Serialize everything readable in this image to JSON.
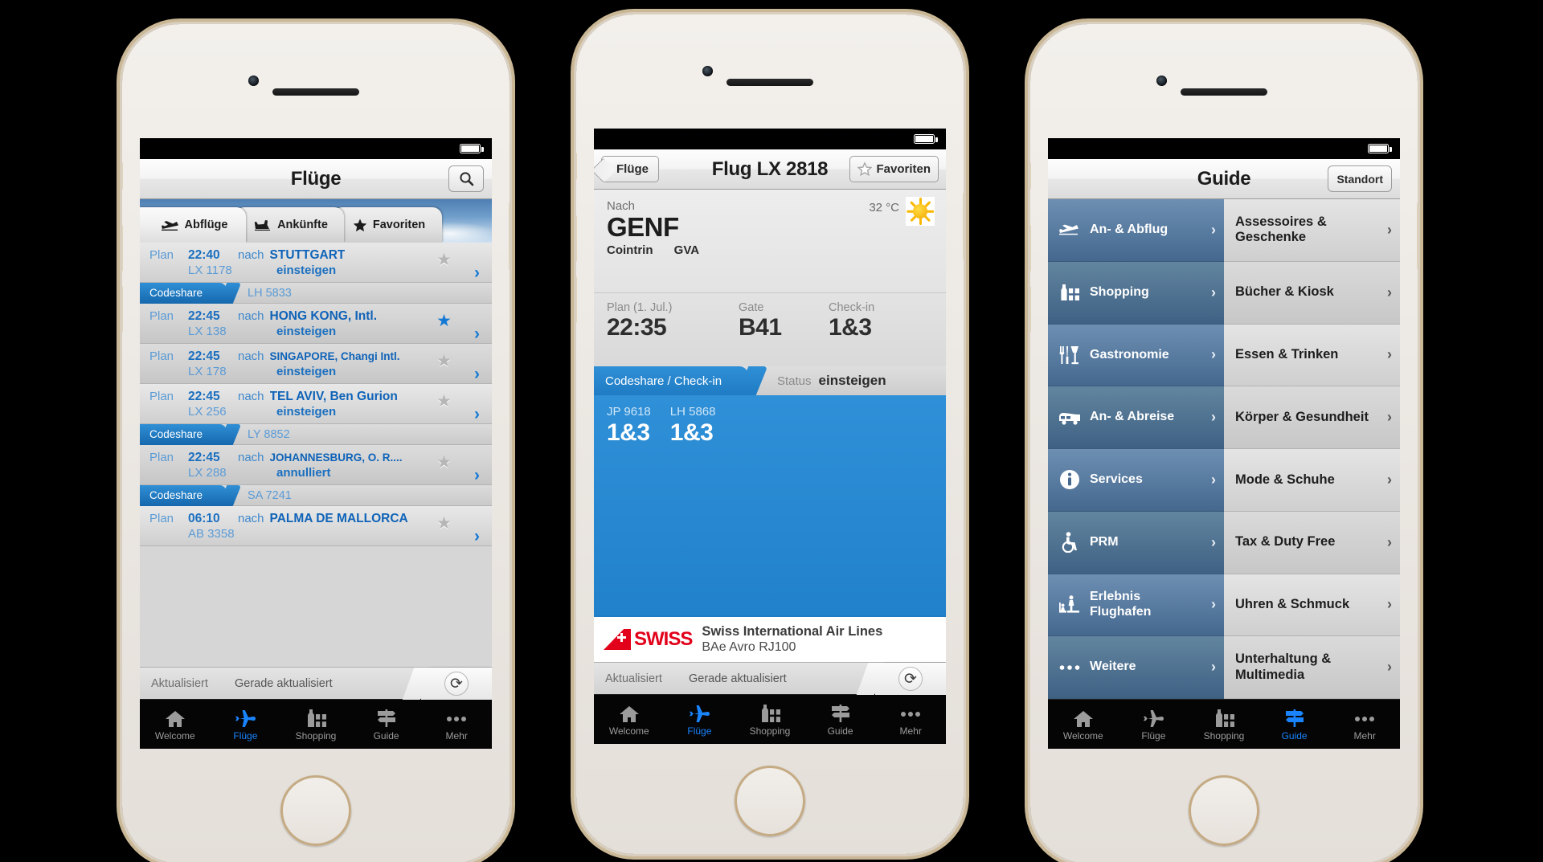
{
  "phone1": {
    "statusbar": {
      "battery": "battery-icon"
    },
    "navbar": {
      "title": "Flüge",
      "search_icon": "search-icon"
    },
    "tabs": [
      {
        "label": "Abflüge",
        "icon": "departure-plane-icon",
        "active": true
      },
      {
        "label": "Ankünfte",
        "icon": "arrival-plane-icon",
        "active": false
      },
      {
        "label": "Favoriten",
        "icon": "star-icon",
        "active": false
      }
    ],
    "flights": [
      {
        "plan": "Plan",
        "time": "22:40",
        "nach": "nach",
        "dest": "STUTTGART",
        "number": "LX 1178",
        "status": "einsteigen",
        "fav": false,
        "codeshare": {
          "tag": "Codeshare",
          "number": "LH 5833"
        }
      },
      {
        "plan": "Plan",
        "time": "22:45",
        "nach": "nach",
        "dest": "HONG KONG, Intl.",
        "number": "LX 138",
        "status": "einsteigen",
        "fav": true,
        "codeshare": null
      },
      {
        "plan": "Plan",
        "time": "22:45",
        "nach": "nach",
        "dest": "SINGAPORE, Changi Intl.",
        "number": "LX 178",
        "status": "einsteigen",
        "fav": false,
        "codeshare": null
      },
      {
        "plan": "Plan",
        "time": "22:45",
        "nach": "nach",
        "dest": "TEL AVIV, Ben Gurion",
        "number": "LX 256",
        "status": "einsteigen",
        "fav": false,
        "codeshare": {
          "tag": "Codeshare",
          "number": "LY 8852"
        }
      },
      {
        "plan": "Plan",
        "time": "22:45",
        "nach": "nach",
        "dest": "JOHANNESBURG, O. R....",
        "number": "LX 288",
        "status": "annulliert",
        "fav": false,
        "codeshare": {
          "tag": "Codeshare",
          "number": "SA 7241"
        }
      },
      {
        "plan": "Plan",
        "time": "06:10",
        "nach": "nach",
        "dest": "PALMA DE MALLORCA",
        "number": "AB 3358",
        "status": "",
        "fav": false,
        "codeshare": null
      }
    ],
    "refreshbar": {
      "left": "Aktualisiert",
      "center": "Gerade aktualisiert",
      "icon": "refresh-icon"
    },
    "tabbar": [
      {
        "label": "Welcome",
        "icon": "home-icon",
        "active": false
      },
      {
        "label": "Flüge",
        "icon": "plane-icon",
        "active": true
      },
      {
        "label": "Shopping",
        "icon": "shopping-icon",
        "active": false
      },
      {
        "label": "Guide",
        "icon": "signpost-icon",
        "active": false
      },
      {
        "label": "Mehr",
        "icon": "ellipsis-icon",
        "active": false
      }
    ]
  },
  "phone2": {
    "navbar": {
      "back": "Flüge",
      "title": "Flug LX 2818",
      "fav_label": "Favoriten",
      "fav_icon": "star-outline-icon"
    },
    "detail": {
      "nach_label": "Nach",
      "city": "GENF",
      "airport": "Cointrin",
      "iata": "GVA",
      "temperature": "32 °C",
      "weather_icon": "sun-icon",
      "fields": [
        {
          "label": "Plan (1. Jul.)",
          "value": "22:35"
        },
        {
          "label": "Gate",
          "value": "B41"
        },
        {
          "label": "Check-in",
          "value": "1&3"
        }
      ],
      "codeshare_header": {
        "tag": "Codeshare / Check-in",
        "status_label": "Status",
        "status_value": "einsteigen"
      },
      "codeshare_items": [
        {
          "number": "JP 9618",
          "checkin": "1&3"
        },
        {
          "number": "LH 5868",
          "checkin": "1&3"
        }
      ],
      "airline": {
        "logo": "swiss-logo",
        "logo_word": "SWISS",
        "name": "Swiss International Air Lines",
        "aircraft": "BAe Avro RJ100"
      }
    },
    "refreshbar": {
      "left": "Aktualisiert",
      "center": "Gerade aktualisiert",
      "icon": "refresh-icon"
    },
    "tabbar": [
      {
        "label": "Welcome",
        "icon": "home-icon",
        "active": false
      },
      {
        "label": "Flüge",
        "icon": "plane-icon",
        "active": true
      },
      {
        "label": "Shopping",
        "icon": "shopping-icon",
        "active": false
      },
      {
        "label": "Guide",
        "icon": "signpost-icon",
        "active": false
      },
      {
        "label": "Mehr",
        "icon": "ellipsis-icon",
        "active": false
      }
    ]
  },
  "phone3": {
    "navbar": {
      "title": "Guide",
      "button": "Standort"
    },
    "left_items": [
      {
        "label": "An- & Abflug",
        "icon": "departure-plane-icon",
        "chevron": "›"
      },
      {
        "label": "Shopping",
        "icon": "shopping-icon",
        "chevron": "›"
      },
      {
        "label": "Gastronomie",
        "icon": "cutlery-icon",
        "chevron": "›"
      },
      {
        "label": "An- & Abreise",
        "icon": "train-icon",
        "chevron": "›"
      },
      {
        "label": "Services",
        "icon": "info-icon",
        "chevron": "›"
      },
      {
        "label": "PRM",
        "icon": "wheelchair-icon",
        "chevron": "›"
      },
      {
        "label": "Erlebnis Flughafen",
        "icon": "observation-deck-icon",
        "chevron": "›"
      },
      {
        "label": "Weitere",
        "icon": "ellipsis-icon",
        "chevron": "›"
      }
    ],
    "right_items": [
      {
        "label": "Assessoires & Geschenke",
        "chevron": "›"
      },
      {
        "label": "Bücher & Kiosk",
        "chevron": "›"
      },
      {
        "label": "Essen & Trinken",
        "chevron": "›"
      },
      {
        "label": "Körper & Gesundheit",
        "chevron": "›"
      },
      {
        "label": "Mode & Schuhe",
        "chevron": "›"
      },
      {
        "label": "Tax & Duty Free",
        "chevron": "›"
      },
      {
        "label": "Uhren & Schmuck",
        "chevron": "›"
      },
      {
        "label": "Unterhaltung & Multimedia",
        "chevron": "›"
      }
    ],
    "tabbar": [
      {
        "label": "Welcome",
        "icon": "home-icon",
        "active": false
      },
      {
        "label": "Flüge",
        "icon": "plane-icon",
        "active": false
      },
      {
        "label": "Shopping",
        "icon": "shopping-icon",
        "active": false
      },
      {
        "label": "Guide",
        "icon": "signpost-icon",
        "active": true
      },
      {
        "label": "Mehr",
        "icon": "ellipsis-icon",
        "active": false
      }
    ]
  },
  "colors": {
    "accent_blue": "#1a84ff",
    "link_blue": "#1a6fc0",
    "codeshare_blue": "#2181ca",
    "guide_blue": "#4d6f92",
    "swiss_red": "#e2001a",
    "sun_yellow": "#f9b700"
  }
}
